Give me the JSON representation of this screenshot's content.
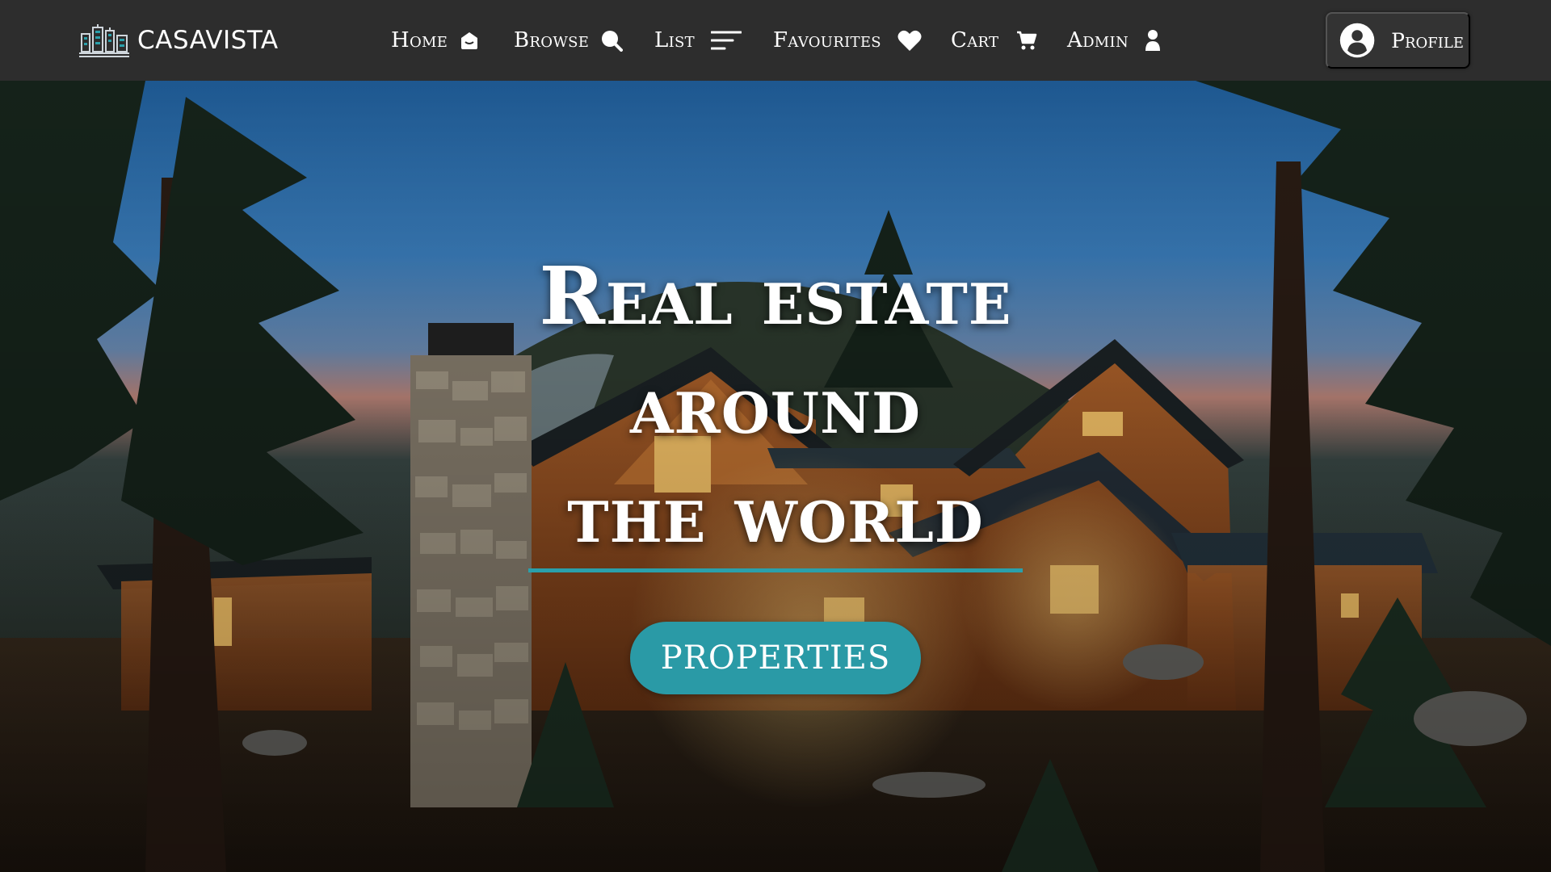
{
  "brand": {
    "name": "CASAVISTA",
    "logo_icon": "city-skyline-logo"
  },
  "nav": {
    "items": [
      {
        "label": "Home",
        "icon": "home-icon"
      },
      {
        "label": "Browse",
        "icon": "search-icon"
      },
      {
        "label": "List",
        "icon": "list-lines-icon"
      },
      {
        "label": "Favourites",
        "icon": "heart-icon"
      },
      {
        "label": "Cart",
        "icon": "cart-icon"
      },
      {
        "label": "Admin",
        "icon": "user-icon"
      }
    ],
    "profile": {
      "label": "Profile",
      "icon": "user-circle-icon"
    }
  },
  "hero": {
    "headline_lines": [
      "Real estate",
      "around",
      "the world"
    ],
    "cta_label": "PROPERTIES",
    "background": "mountain-lodge-at-dusk-photo"
  },
  "colors": {
    "navbar_bg": "#2d2d2d",
    "accent": "#2a9aa6",
    "text": "#ffffff"
  }
}
